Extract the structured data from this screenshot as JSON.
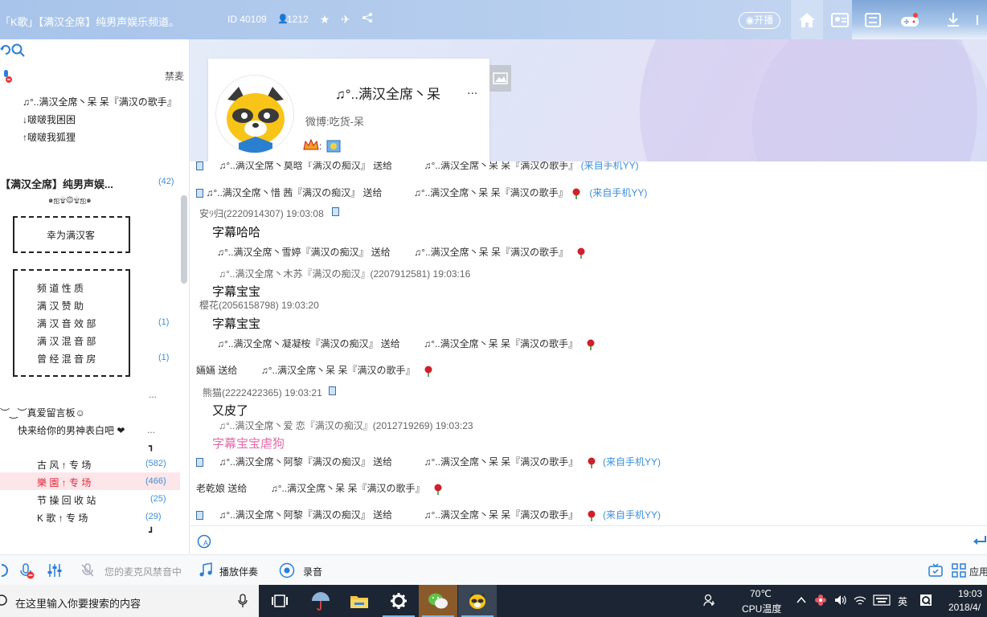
{
  "titlebar": {
    "title": "「K歌」【满汉全席】纯男声娱乐频道。",
    "channel_id": "ID 40109",
    "members": "1212",
    "kaibo": "开播"
  },
  "left": {
    "ban_label": "禁麦",
    "speakers": [
      "♫°..满汉全席丶呆  呆『满汉の歌手』",
      "↓啵啵我困困",
      "↑啵啵我狐狸"
    ],
    "channel": {
      "name": "【满汉全席】纯男声娱...",
      "count": "(42)"
    },
    "deco": "๑ஐ۩۞۩ஐ๑",
    "welcome": "幸为满汉客",
    "groups": [
      {
        "label": "频 道 性 质",
        "count": ""
      },
      {
        "label": "满 汉 赞 助",
        "count": ""
      },
      {
        "label": "满 汉 音 效 部",
        "count": "(1)"
      },
      {
        "label": "满 汉 混 音 部",
        "count": ""
      },
      {
        "label": "曾 经 混 音 房",
        "count": "(1)"
      }
    ],
    "dots1": "...",
    "board": "︶‿︶真爱留言板☺",
    "board_msg": "快来给你的男神表白吧 ❤",
    "dots2": "...",
    "rooms": [
      {
        "label": "古 风 ↑ 专 场",
        "count": "(582)"
      },
      {
        "label": "樂 園 ↑ 专 场",
        "count": "(466)"
      },
      {
        "label": "节 操 回 收 站",
        "count": "(25)"
      },
      {
        "label": "K 歌 ↑ 专 场",
        "count": "(29)"
      }
    ]
  },
  "profile": {
    "name": "♫°..满汉全席丶呆",
    "more": "...",
    "weibo": "微博:吃货-呆"
  },
  "chat": {
    "gift1": {
      "from": "♫°..满汉全席丶莫晗『满汉の痴汉』 送给",
      "to": "♫°..满汉全席丶呆  呆『满汉の歌手』",
      "tag": "(来自手机YY)"
    },
    "gift2": {
      "from": "♫°..满汉全席丶惜  茜『满汉の痴汉』 送给",
      "to": "♫°..满汉全席丶呆  呆『满汉の歌手』",
      "tag": "(来自手机YY)"
    },
    "user1": "安୨归(2220914307) 19:03:08",
    "text1": "字幕哈哈",
    "gift3": {
      "from": "♫°..满汉全席丶雪婷『满汉の痴汉』 送给",
      "to": "♫°..满汉全席丶呆  呆『满汉の歌手』"
    },
    "user2": "♫°..满汉全席丶木苏『满汉の痴汉』(2207912581) 19:03:16",
    "text2": "字幕宝宝",
    "user3": "樱花(2056158798) 19:03:20",
    "text3": "字幕宝宝",
    "gift4": {
      "from": "♫°..满汉全席丶凝凝桉『满汉の痴汉』 送给",
      "to": "♫°..满汉全席丶呆  呆『满汉の歌手』"
    },
    "gift5": {
      "from": "婳婳 送给",
      "to": "♫°..满汉全席丶呆  呆『满汉の歌手』"
    },
    "user4": "熊猫(2222422365) 19:03:21",
    "text4": "又皮了",
    "user5": "♫°..满汉全席丶爱 恋『满汉の痴汉』(2012719269) 19:03:23",
    "text5": "字幕宝宝虐狗",
    "gift6": {
      "from": "♫°..满汉全席丶阿黎『满汉の痴汉』 送给",
      "to": "♫°..满汉全席丶呆  呆『满汉の歌手』",
      "tag": "(来自手机YY)"
    },
    "gift7": {
      "from": "老乾娘 送给",
      "to": "♫°..满汉全席丶呆  呆『满汉の歌手』"
    },
    "gift8": {
      "from": "♫°..满汉全席丶阿黎『满汉の痴汉』 送给",
      "to": "♫°..满汉全席丶呆  呆『满汉の歌手』",
      "tag": "(来自手机YY)"
    }
  },
  "toolbar": {
    "mic_status": "您的麦克风禁音中",
    "play": "播放伴奏",
    "record": "录音",
    "apps": "应用"
  },
  "taskbar": {
    "search_placeholder": "在这里输入你要搜索的内容",
    "temp": "70℃",
    "cpu": "CPU温度",
    "ime": "英",
    "time": "19:03",
    "date": "2018/4/"
  },
  "colors": {
    "accent": "#3c8fd8",
    "pink": "#e06aa8",
    "titlebar": "#b3cbee"
  }
}
